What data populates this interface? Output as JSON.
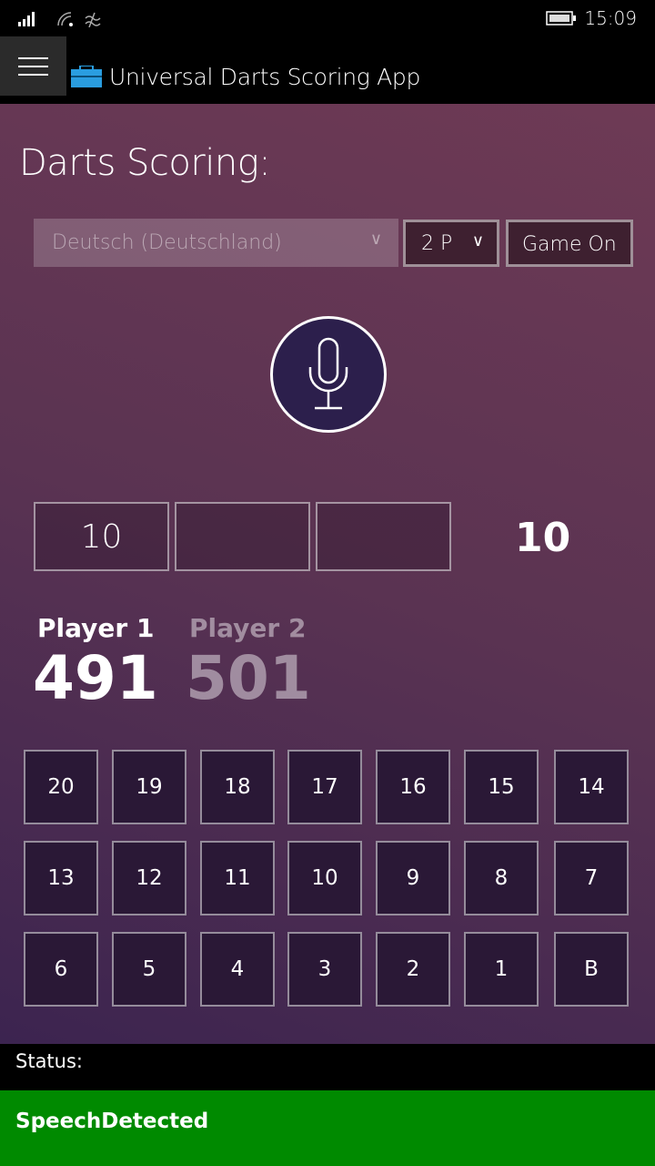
{
  "system": {
    "time": "15:09"
  },
  "app": {
    "title": "Universal Darts Scoring App"
  },
  "main": {
    "heading": "Darts Scoring:",
    "language_select": {
      "value": "Deutsch (Deutschland)"
    },
    "players_select": {
      "value": "2 P"
    },
    "game_on_label": "Game On",
    "darts": [
      "10",
      "",
      ""
    ],
    "round_total": "10",
    "players": [
      {
        "name": "Player 1",
        "score": "491",
        "active": true
      },
      {
        "name": "Player 2",
        "score": "501",
        "active": false
      }
    ],
    "numbers": [
      "20",
      "19",
      "18",
      "17",
      "16",
      "15",
      "14",
      "13",
      "12",
      "11",
      "10",
      "9",
      "8",
      "7",
      "6",
      "5",
      "4",
      "3",
      "2",
      "1",
      "B"
    ]
  },
  "status": {
    "label": "Status:",
    "value": "SpeechDetected",
    "color": "#008a00"
  }
}
